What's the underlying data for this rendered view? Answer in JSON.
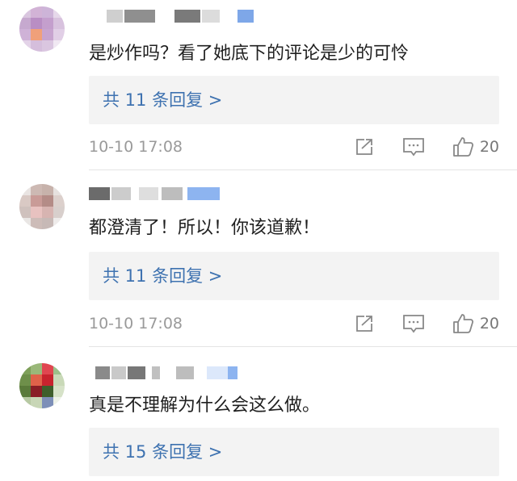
{
  "comments": [
    {
      "text": "是炒作吗？看了她底下的评论是少的可怜",
      "replies_label": "共 11 条回复 >",
      "time": "10-10 17:08",
      "likes": "20",
      "icons": [
        "share-icon",
        "comment-icon",
        "like-icon"
      ]
    },
    {
      "text": "都澄清了！所以！你该道歉！",
      "replies_label": "共 11 条回复 >",
      "time": "10-10 17:08",
      "likes": "20",
      "icons": [
        "share-icon",
        "comment-icon",
        "like-icon"
      ]
    },
    {
      "text": "真是不理解为什么会这么做。",
      "replies_label": "共 15 条回复 >",
      "icons": []
    }
  ],
  "colors": {
    "link": "#3e72b0",
    "reply_bg": "#f3f3f3",
    "meta": "#9a9a9a"
  }
}
